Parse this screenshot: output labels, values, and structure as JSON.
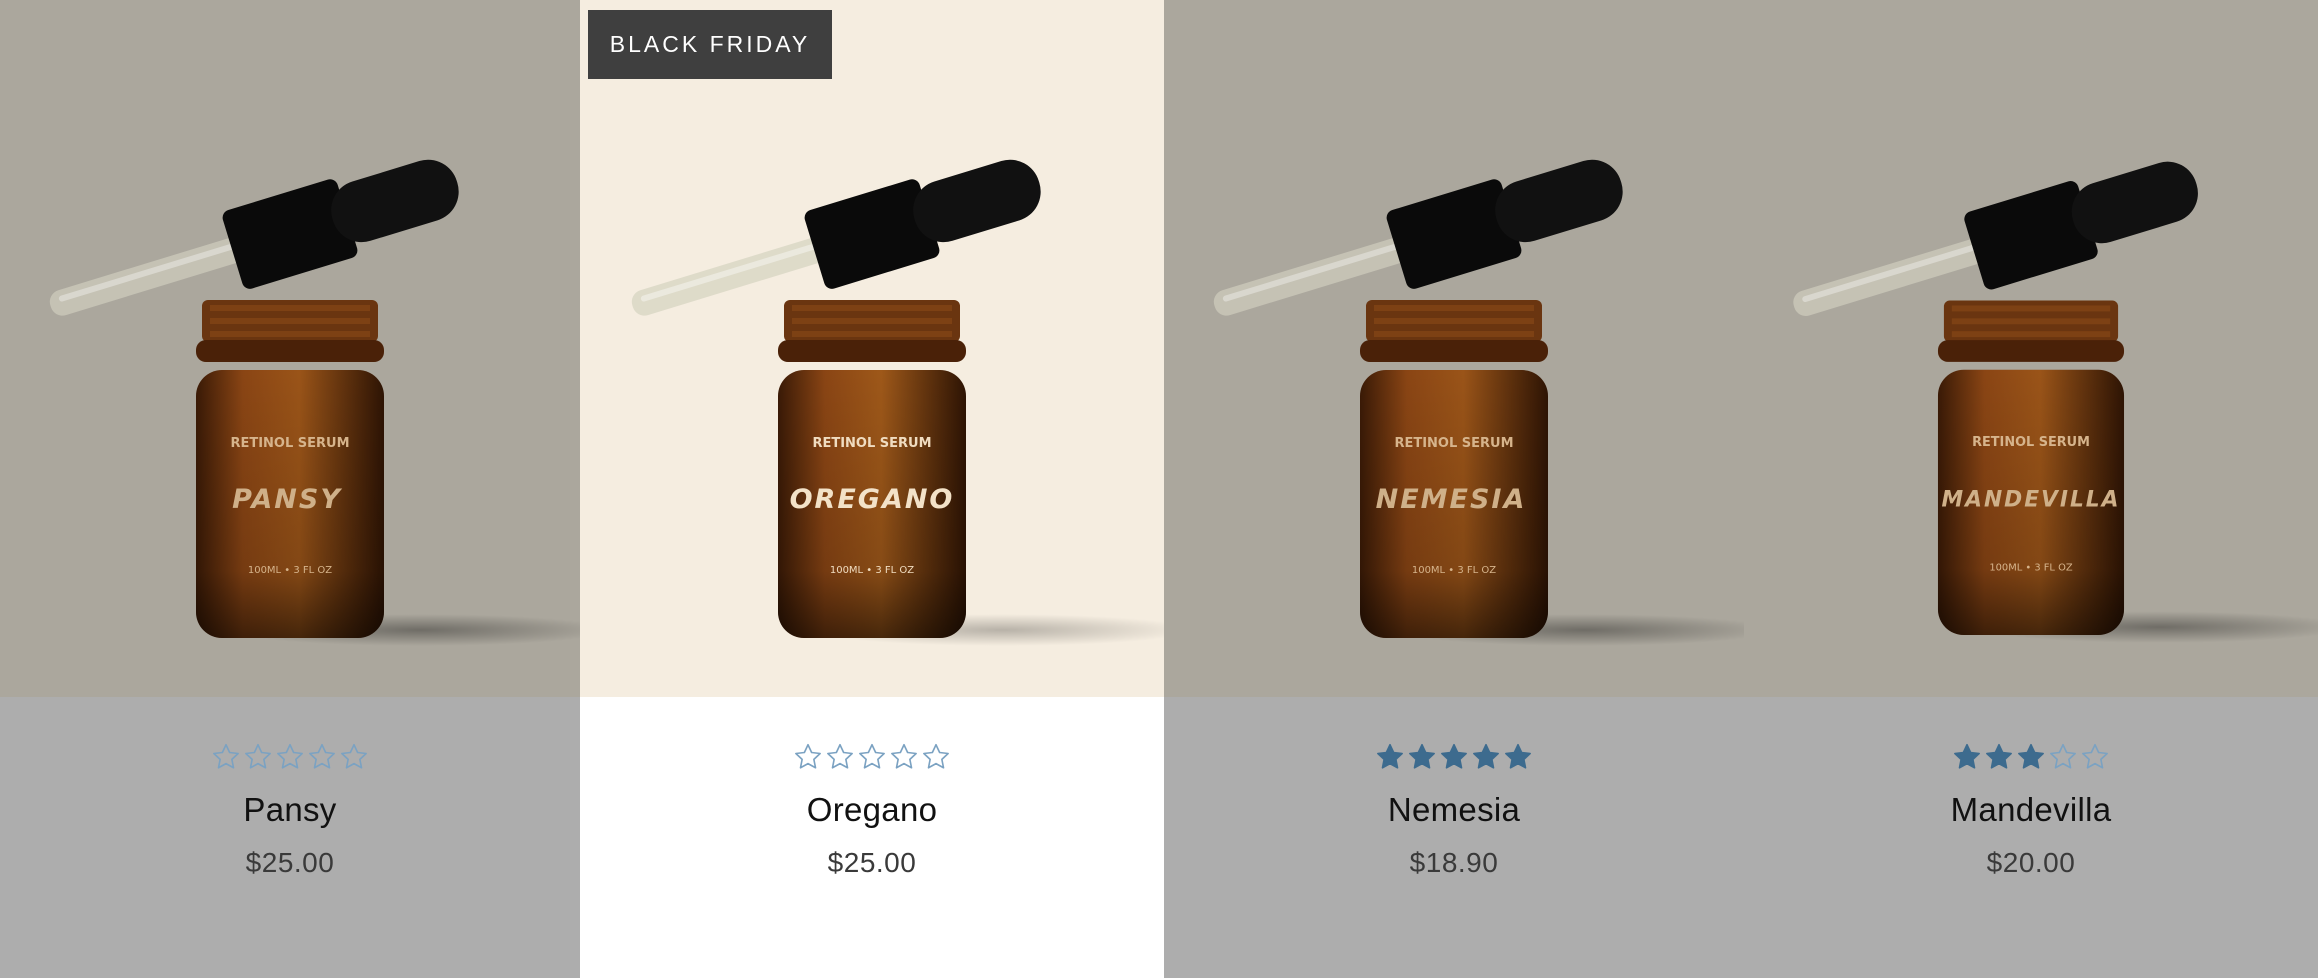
{
  "badge": {
    "label": "BLACK FRIDAY"
  },
  "colors": {
    "card_bg_grey": "#aba79d",
    "card_bg_cream": "#f5ede0",
    "info_bg_grey": "#adadad",
    "info_bg_white": "#ffffff",
    "star_color": "#3d6b8e",
    "badge_bg": "#3f3f3f"
  },
  "products": [
    {
      "name": "Pansy",
      "price": "$25.00",
      "rating": 0,
      "label_line1": "RETINOL SERUM",
      "label_name": "PANSY",
      "label_volume": "100ML • 3 FL OZ",
      "background": "grey"
    },
    {
      "name": "Oregano",
      "price": "$25.00",
      "rating": 0,
      "label_line1": "RETINOL SERUM",
      "label_name": "OREGANO",
      "label_volume": "100ML • 3 FL OZ",
      "background": "cream"
    },
    {
      "name": "Nemesia",
      "price": "$18.90",
      "rating": 5,
      "label_line1": "RETINOL SERUM",
      "label_name": "NEMESIA",
      "label_volume": "100ML • 3 FL OZ",
      "background": "grey"
    },
    {
      "name": "Mandevilla",
      "price": "$20.00",
      "rating": 3,
      "label_line1": "RETINOL SERUM",
      "label_name": "MANDEVILLA",
      "label_volume": "100ML • 3 FL OZ",
      "background": "grey"
    }
  ]
}
